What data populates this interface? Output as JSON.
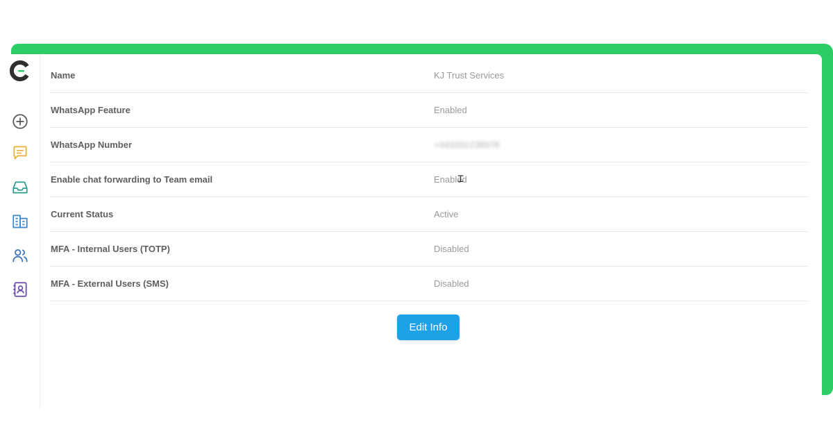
{
  "brand": {
    "accent_color": "#2ecc65",
    "logo_icon": "brand-logo-icon"
  },
  "sidebar": {
    "items": [
      {
        "name": "add",
        "icon": "plus-circle-icon",
        "color": "#555555"
      },
      {
        "name": "chats",
        "icon": "chat-bubble-icon",
        "color": "#e8b23a"
      },
      {
        "name": "inbox",
        "icon": "inbox-tray-icon",
        "color": "#2a9d8f"
      },
      {
        "name": "directory",
        "icon": "buildings-icon",
        "color": "#3a86d1"
      },
      {
        "name": "users",
        "icon": "users-icon",
        "color": "#3a72b8"
      },
      {
        "name": "contacts",
        "icon": "contact-book-icon",
        "color": "#6a4aa8"
      }
    ]
  },
  "details": {
    "rows": [
      {
        "label": "Name",
        "value": "KJ Trust Services"
      },
      {
        "label": "WhatsApp Feature",
        "value": "Enabled"
      },
      {
        "label": "WhatsApp Number",
        "value": "+443331238978"
      },
      {
        "label": "Enable chat forwarding to Team email",
        "value": "Enabled"
      },
      {
        "label": "Current Status",
        "value": "Active"
      },
      {
        "label": "MFA - Internal Users (TOTP)",
        "value": "Disabled"
      },
      {
        "label": "MFA - External Users (SMS)",
        "value": "Disabled"
      }
    ]
  },
  "actions": {
    "edit_label": "Edit Info",
    "edit_color": "#1ea1e6"
  }
}
